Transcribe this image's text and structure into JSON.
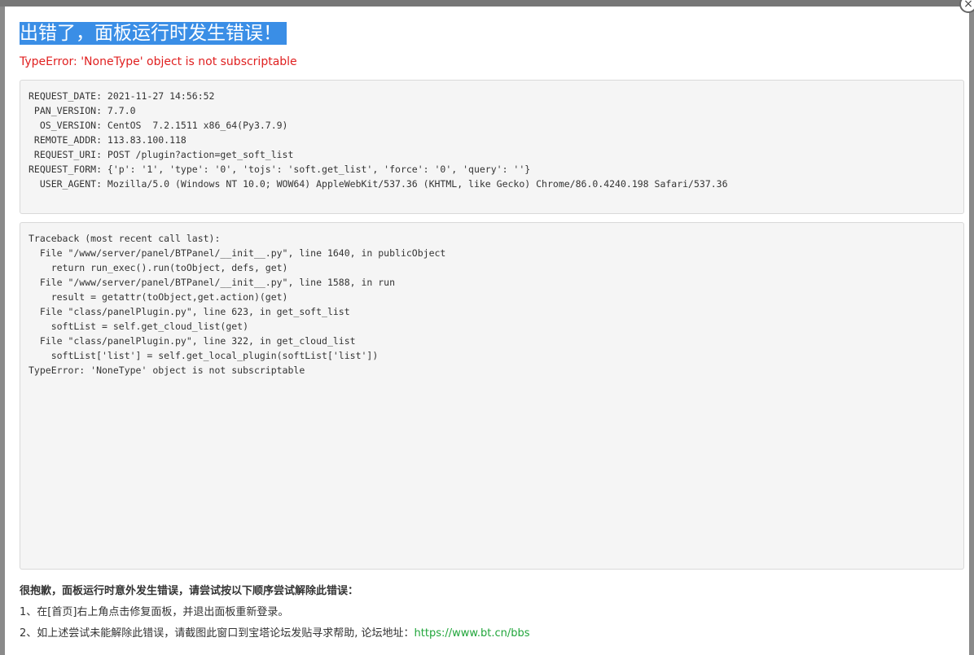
{
  "modal": {
    "close_glyph": "×",
    "title": "出错了，面板运行时发生错误！",
    "error_message": "TypeError: 'NoneType' object is not subscriptable"
  },
  "request_info": [
    "REQUEST_DATE: 2021-11-27 14:56:52",
    " PAN_VERSION: 7.7.0",
    "  OS_VERSION: CentOS  7.2.1511 x86_64(Py3.7.9)",
    " REMOTE_ADDR: 113.83.100.118",
    " REQUEST_URI: POST /plugin?action=get_soft_list",
    "REQUEST_FORM: {'p': '1', 'type': '0', 'tojs': 'soft.get_list', 'force': '0', 'query': ''}",
    "  USER_AGENT: Mozilla/5.0 (Windows NT 10.0; WOW64) AppleWebKit/537.36 (KHTML, like Gecko) Chrome/86.0.4240.198 Safari/537.36"
  ],
  "traceback": [
    "Traceback (most recent call last):",
    "  File \"/www/server/panel/BTPanel/__init__.py\", line 1640, in publicObject",
    "    return run_exec().run(toObject, defs, get)",
    "  File \"/www/server/panel/BTPanel/__init__.py\", line 1588, in run",
    "    result = getattr(toObject,get.action)(get)",
    "  File \"class/panelPlugin.py\", line 623, in get_soft_list",
    "    softList = self.get_cloud_list(get)",
    "  File \"class/panelPlugin.py\", line 322, in get_cloud_list",
    "    softList['list'] = self.get_local_plugin(softList['list'])",
    "TypeError: 'NoneType' object is not subscriptable"
  ],
  "help": {
    "title": "很抱歉，面板运行时意外发生错误，请尝试按以下顺序尝试解除此错误：",
    "step1": "1、在[首页]右上角点击修复面板，并退出面板重新登录。",
    "step2_prefix": "2、如上述尝试未能解除此错误，请截图此窗口到宝塔论坛发贴寻求帮助, 论坛地址：",
    "forum_url": "https://www.bt.cn/bbs"
  },
  "colors": {
    "title_highlight": "#3a8ee6",
    "error_text": "#e02020",
    "link": "#20a53a"
  }
}
